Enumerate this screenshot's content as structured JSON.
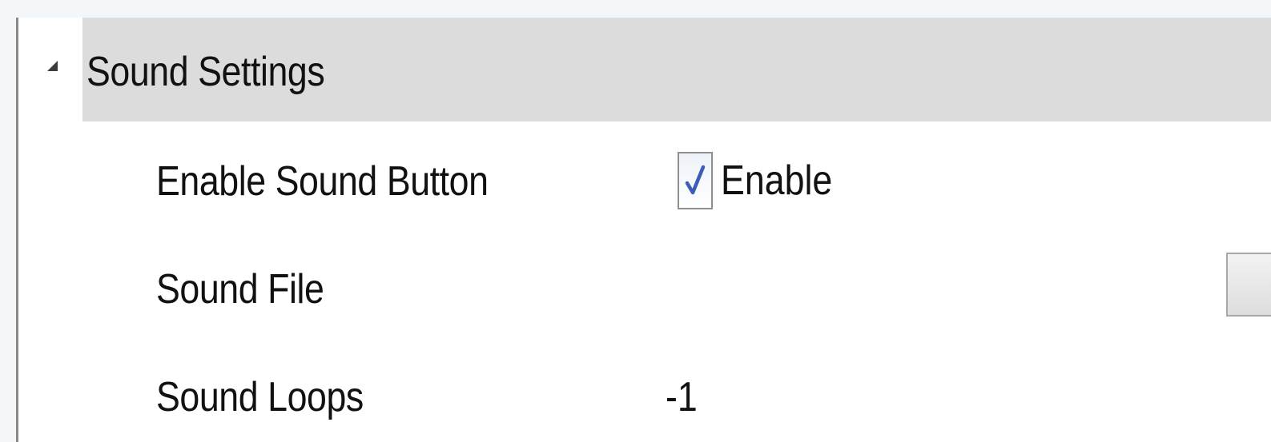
{
  "group": {
    "title": "Sound Settings",
    "expanded": true
  },
  "properties": [
    {
      "label": "Enable Sound Button",
      "checkbox_label": "Enable",
      "checked": true
    },
    {
      "label": "Sound File",
      "value": ""
    },
    {
      "label": "Sound Loops",
      "value": "-1"
    }
  ],
  "icons": {
    "collapse": "collapse-triangle-icon",
    "check": "checkmark-icon"
  },
  "colors": {
    "header_bg": "#dcdcdc",
    "checkmark": "#3a5fb5",
    "background": "#ffffff"
  }
}
